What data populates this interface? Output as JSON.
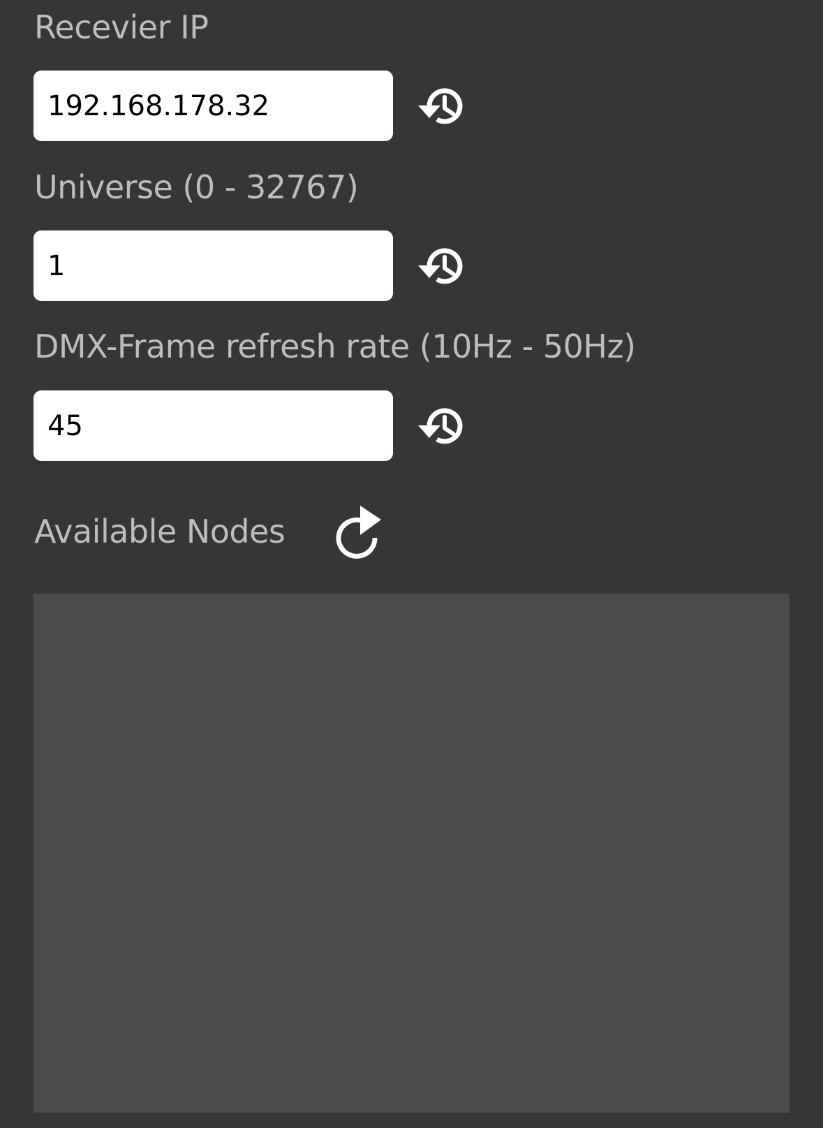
{
  "colors": {
    "background": "#373536",
    "label_text": "#bdbdbd",
    "field_background": "#ffffff",
    "field_text": "#000000",
    "icon": "#ffffff",
    "nodes_panel": "#4c4b4a"
  },
  "receiver_ip": {
    "label": "Recevier IP",
    "value": "192.168.178.32",
    "history_icon": "history-icon"
  },
  "universe": {
    "label": "Universe (0 - 32767)",
    "value": "1",
    "history_icon": "history-icon"
  },
  "refresh_rate": {
    "label": "DMX-Frame refresh rate (10Hz - 50Hz)",
    "value": "45",
    "history_icon": "history-icon"
  },
  "available_nodes": {
    "label": "Available Nodes",
    "refresh_icon": "refresh-icon",
    "items": []
  }
}
